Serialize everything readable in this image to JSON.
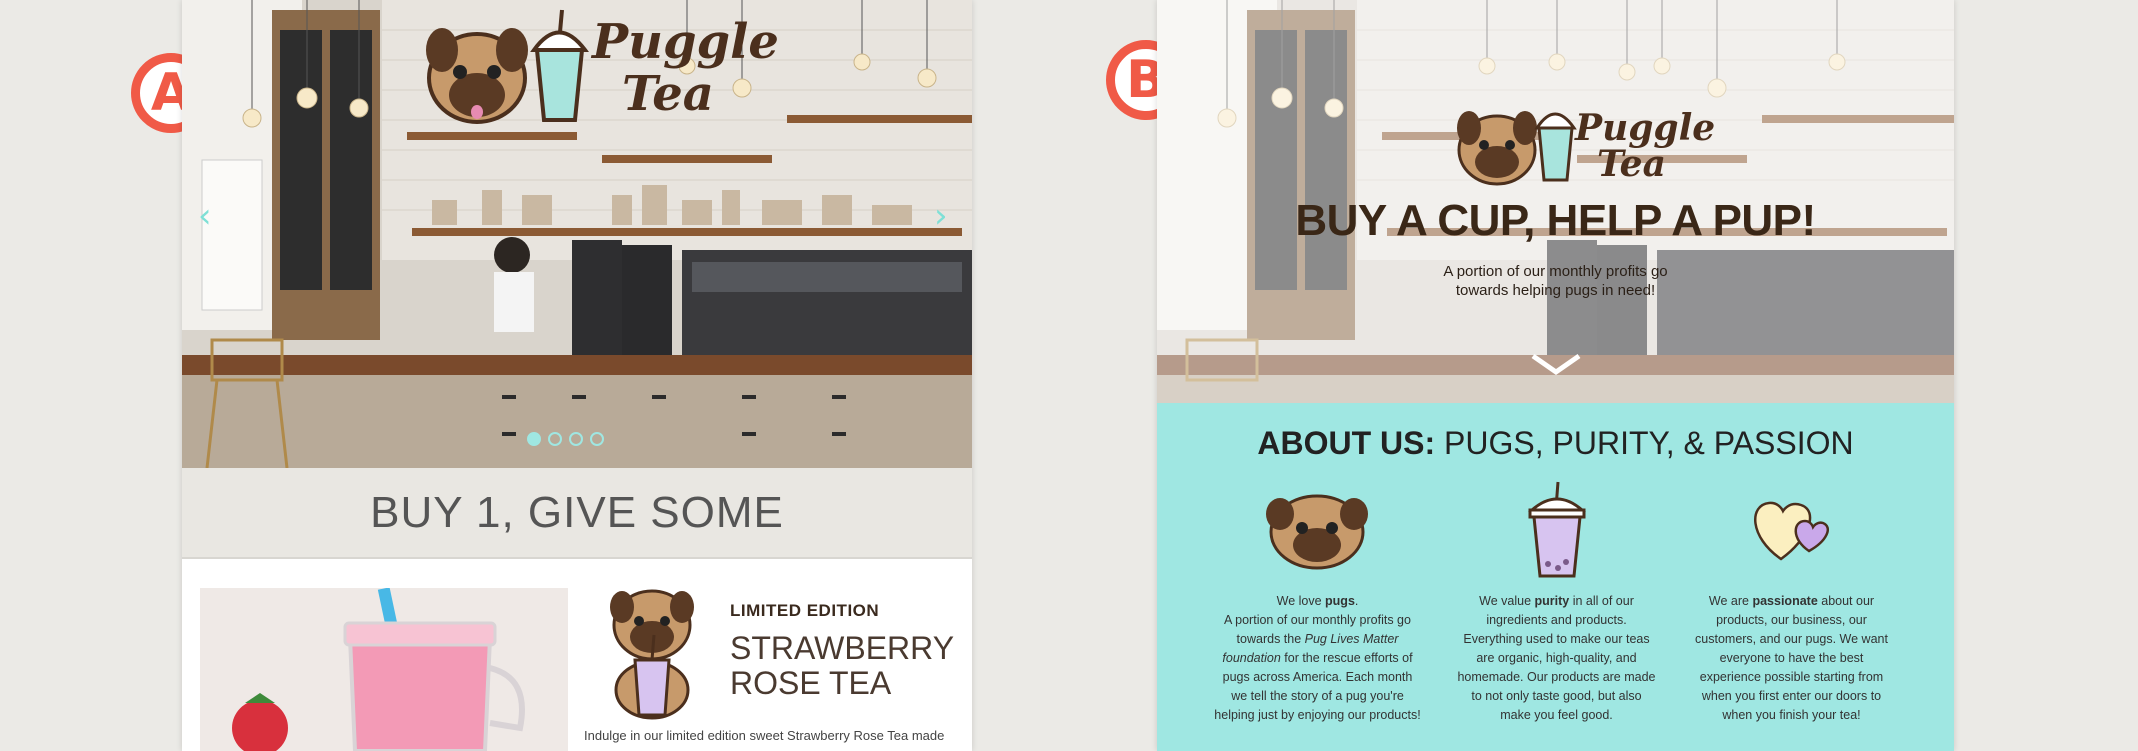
{
  "labels": {
    "a": "A",
    "b": "B"
  },
  "brand": {
    "line1": "Puggle",
    "line2": "Tea"
  },
  "panel_a": {
    "carousel": {
      "prev_arrow": "‹",
      "next_arrow": "›",
      "slide_count": 4,
      "active_slide": 1
    },
    "band_title": "BUY 1, GIVE SOME",
    "product": {
      "tag": "LIMITED EDITION",
      "title_line1": "STRAWBERRY",
      "title_line2": "ROSE TEA",
      "description": "Indulge in our limited edition sweet Strawberry Rose Tea made"
    }
  },
  "panel_b": {
    "hero_title": "BUY A CUP, HELP A PUP!",
    "hero_sub_line1": "A portion of our monthly profits go",
    "hero_sub_line2": "towards helping pugs in need!",
    "about_bold": "ABOUT US:",
    "about_rest": " PUGS, PURITY, & PASSION",
    "columns": [
      {
        "intro_pre": "We love ",
        "intro_bold": "pugs",
        "intro_post": ".",
        "line_a": "A portion of our monthly profits go",
        "line_b_pre": "towards the ",
        "line_b_em": "Pug Lives Matter",
        "line_c_em": "foundation",
        "line_c_post": " for the rescue efforts of",
        "line_d": "pugs across America. Each month",
        "line_e": "we tell the story of a pug you're",
        "line_f": "helping just by enjoying our products!"
      },
      {
        "intro_pre": "We  value ",
        "intro_bold": "purity",
        "intro_post": " in all of our",
        "line_a": "ingredients and products.",
        "line_b": "Everything used to make our teas",
        "line_c": "are organic, high-quality, and",
        "line_d": "homemade.  Our products are made",
        "line_e": "to not only taste good, but also",
        "line_f": "make you feel good."
      },
      {
        "intro_pre": "We are ",
        "intro_bold": "passionate",
        "intro_post": " about our",
        "line_a": "products, our business, our",
        "line_b": "customers, and our pugs.  We want",
        "line_c": "everyone to have the best",
        "line_d": "experience possible starting from",
        "line_e": "when you first enter our doors to",
        "line_f": "when you finish your tea!"
      }
    ]
  },
  "colors": {
    "badge": "#f05a47",
    "teal": "#9fe7e2",
    "brown": "#4b2f1d"
  },
  "icons": [
    "pug-face-icon",
    "bubble-tea-cup-icon",
    "hearts-icon",
    "chevron-down-icon",
    "chevron-left-icon",
    "chevron-right-icon"
  ]
}
